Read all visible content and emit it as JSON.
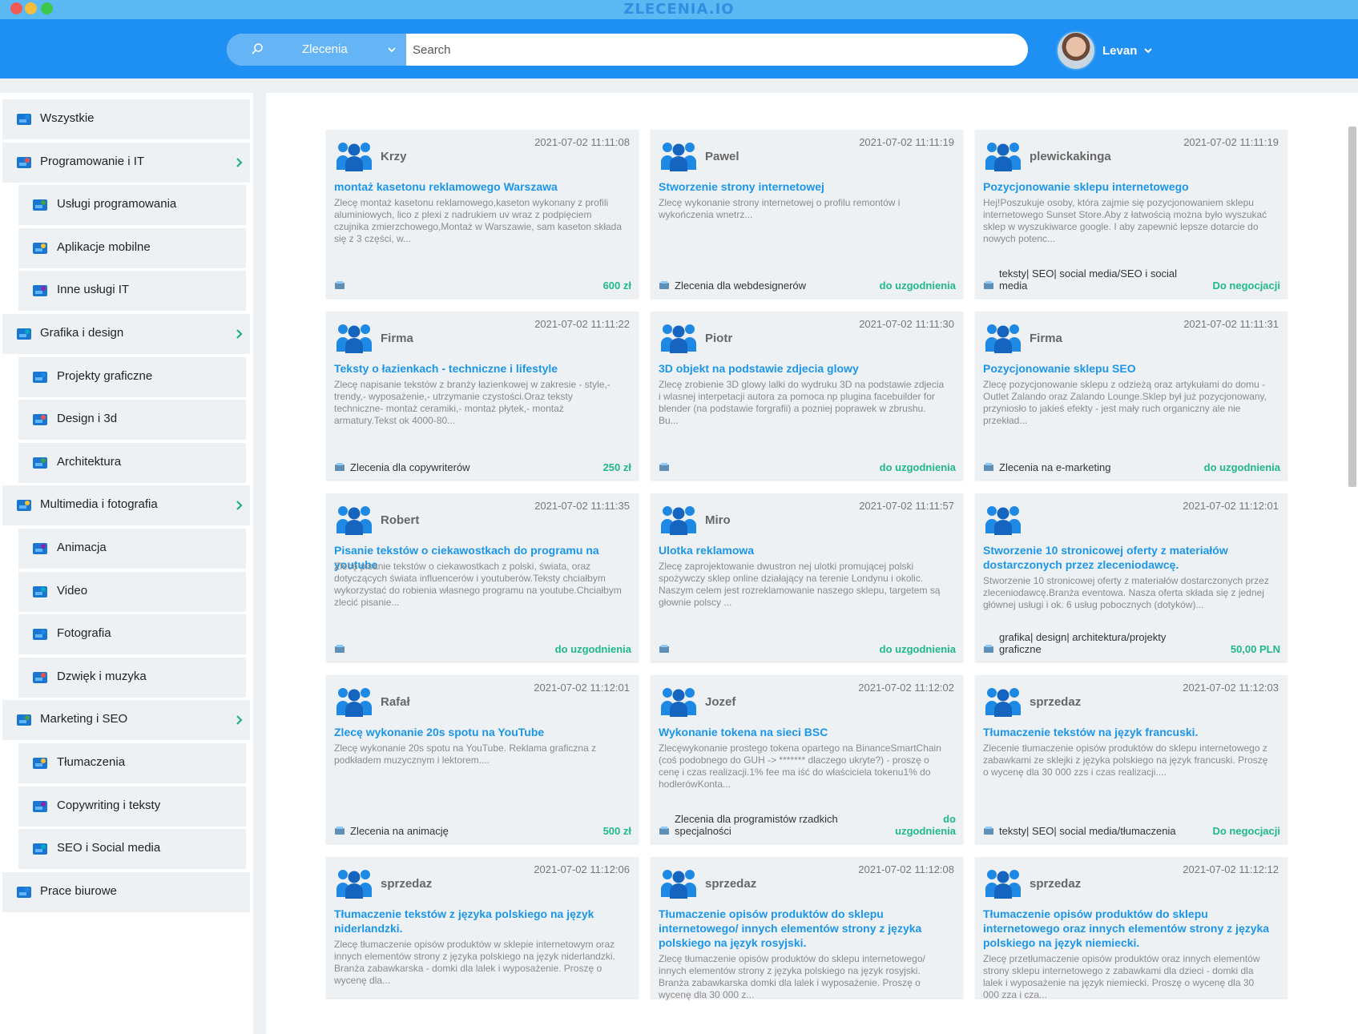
{
  "app": {
    "title": "ZLECENIA.IO"
  },
  "search": {
    "category": "Zlecenia",
    "placeholder": "Search"
  },
  "user": {
    "name": "Levan"
  },
  "sidebar": {
    "items": [
      {
        "label": "Wszystkie",
        "level": "top",
        "arrow": false,
        "icon": "network-icon"
      },
      {
        "label": "Programowanie i IT",
        "level": "top",
        "arrow": true,
        "icon": "molecule-icon"
      },
      {
        "label": "Usługi programowania",
        "level": "sub",
        "arrow": false,
        "icon": "molecule-icon"
      },
      {
        "label": "Aplikacje mobilne",
        "level": "sub",
        "arrow": false,
        "icon": "mobile-icon"
      },
      {
        "label": "Inne usługi IT",
        "level": "sub",
        "arrow": false,
        "icon": "laptop-icon"
      },
      {
        "label": "Grafika i design",
        "level": "top",
        "arrow": true,
        "icon": "pen-tool-icon"
      },
      {
        "label": "Projekty graficzne",
        "level": "sub",
        "arrow": false,
        "icon": "browser-window-icon"
      },
      {
        "label": "Design i 3d",
        "level": "sub",
        "arrow": false,
        "icon": "cube-icon"
      },
      {
        "label": "Architektura",
        "level": "sub",
        "arrow": false,
        "icon": "compass-icon"
      },
      {
        "label": "Multimedia i fotografia",
        "level": "top",
        "arrow": true,
        "icon": "camera-icon"
      },
      {
        "label": "Animacja",
        "level": "sub",
        "arrow": false,
        "icon": "lamp-icon"
      },
      {
        "label": "Video",
        "level": "sub",
        "arrow": false,
        "icon": "video-icon"
      },
      {
        "label": "Fotografia",
        "level": "sub",
        "arrow": false,
        "icon": "photo-icon"
      },
      {
        "label": "Dzwięk i muzyka",
        "level": "sub",
        "arrow": false,
        "icon": "music-icon"
      },
      {
        "label": "Marketing i SEO",
        "level": "top",
        "arrow": true,
        "icon": "chart-monitor-icon"
      },
      {
        "label": "Tłumaczenia",
        "level": "sub",
        "arrow": false,
        "icon": "translate-icon"
      },
      {
        "label": "Copywriting i teksty",
        "level": "sub",
        "arrow": false,
        "icon": "typewriter-icon"
      },
      {
        "label": "SEO i Social media",
        "level": "sub",
        "arrow": false,
        "icon": "social-icon"
      },
      {
        "label": "Prace biurowe",
        "level": "top",
        "arrow": false,
        "icon": "office-building-icon"
      }
    ]
  },
  "listings": [
    {
      "user": "Krzy",
      "date": "2021-07-02 11:11:08",
      "title": "montaż kasetonu reklamowego Warszawa",
      "desc": "Zlecę montaż kasetonu reklamowego,kaseton wykonany z profili aluminiowych, lico z plexi z nadrukiem uv wraz z podpięciem czujnika zmierzchowego,Montaż w Warszawie, sam kaseton składa się z 3 części, w...",
      "category": "",
      "price": "600 zł"
    },
    {
      "user": "Pawel",
      "date": "2021-07-02 11:11:19",
      "title": "Stworzenie strony internetowej",
      "desc": "Zlecę wykonanie strony internetowej o profilu remontów i wykończenia wnetrz...",
      "category": "Zlecenia dla webdesignerów",
      "price": "do uzgodnienia"
    },
    {
      "user": "plewickakinga",
      "date": "2021-07-02 11:11:19",
      "title": "Pozycjonowanie sklepu internetowego",
      "desc": "Hej!Poszukuje osoby, która zajmie się pozycjonowaniem sklepu internetowego Sunset Store.Aby z łatwością można było wyszukać sklep w wyszukiwarce google. I aby zapewnić lepsze dotarcie do nowych potenc...",
      "category": "teksty| SEO| social media/SEO i social media",
      "price": "Do negocjacji"
    },
    {
      "user": "Firma",
      "date": "2021-07-02 11:11:22",
      "title": "Teksty o łazienkach - techniczne i lifestyle",
      "desc": "Zlecę napisanie tekstów z branży łazienkowej w zakresie - style,- trendy,- wyposażenie,- utrzymanie czystości.Oraz teksty techniczne- montaż ceramiki,- montaż płytek,- montaż armatury.Tekst ok 4000-80...",
      "category": "Zlecenia dla copywriterów",
      "price": "250 zł"
    },
    {
      "user": "Piotr",
      "date": "2021-07-02 11:11:30",
      "title": "3D objekt na podstawie zdjecia glowy",
      "desc": "Zlecę zrobienie 3D glowy lalki do wydruku 3D na podstawie zdjecia i wlasnej interpetacji autora za pomoca np plugina facebuilder for blender (na podstawie forgrafii) a pozniej poprawek w zbrushu. Bu...",
      "category": "",
      "price": "do uzgodnienia"
    },
    {
      "user": "Firma",
      "date": "2021-07-02 11:11:31",
      "title": "Pozycjonowanie sklepu SEO",
      "desc": "Zlecę pozycjonowanie sklepu z odzieżą oraz artykułami do domu - Outlet Zalando oraz Zalando Lounge.Sklep był już pozycjonowany, przyniosło to jakieś efekty - jest mały ruch organiczny ale nie przekład...",
      "category": "Zlecenia na e-marketing",
      "price": "do uzgodnienia"
    },
    {
      "user": "Robert",
      "date": "2021-07-02 11:11:35",
      "title": "Pisanie tekstów o ciekawostkach do programu na youtube",
      "desc": "Zlecę pisanie tekstów o ciekawostkach z polski, świata, oraz dotyczących świata influencerów i youtuberów.Teksty chciałbym wykorzystać do robienia własnego programu na youtube.Chciałbym zlecić pisanie...",
      "category": "",
      "price": "do uzgodnienia"
    },
    {
      "user": "Miro",
      "date": "2021-07-02 11:11:57",
      "title": "Ulotka reklamowa",
      "desc": "Zlecę zaprojektowanie dwustron nej ulotki promującej polski spożywczy sklep online działający na terenie Londynu i okolic. Naszym celem jest rozreklamowanie naszego sklepu, targetem są głownie polscy ...",
      "category": "",
      "price": "do uzgodnienia"
    },
    {
      "user": "",
      "date": "2021-07-02 11:12:01",
      "title": "Stworzenie 10 stronicowej oferty z materiałów dostarczonych przez zleceniodawcę.",
      "desc": "Stworzenie 10 stronicowej oferty z materiałów dostarczonych przez zleceniodawcę.Branża eventowa. Nasza oferta składa się z jednej głównej usługi i ok. 6 usług pobocznych (dotyków)...",
      "category": "grafika| design| architektura/projekty graficzne",
      "price": "50,00 PLN"
    },
    {
      "user": "Rafał",
      "date": "2021-07-02 11:12:01",
      "title": "Zlecę wykonanie 20s spotu na YouTube",
      "desc": "Zlecę wykonanie 20s spotu na YouTube. Reklama graficzna z podkładem muzycznym i lektorem....",
      "category": "Zlecenia na animację",
      "price": "500 zł"
    },
    {
      "user": "Jozef",
      "date": "2021-07-02 11:12:02",
      "title": "Wykonanie tokena na sieci BSC",
      "desc": "Zlecęwykonanie prostego tokena opartego na BinanceSmartChain (coś podobnego do GUH -> ******* dlaczego ukryte?) - proszę o cenę i czas realizacji.1% fee ma iść do właściciela tokenu1% do hodlerówKonta...",
      "category": "Zlecenia dla programistów rzadkich specjalności",
      "price": "do uzgodnienia"
    },
    {
      "user": "sprzedaz",
      "date": "2021-07-02 11:12:03",
      "title": "Tłumaczenie tekstów na język francuski.",
      "desc": "Zlecenie tłumaczenie opisów produktów do sklepu internetowego z zabawkami ze sklejki z języka polskiego na język francuski. Proszę o wycenę dla 30 000 zzs i czas realizacji....",
      "category": "teksty| SEO| social media/tłumaczenia",
      "price": "Do negocjacji"
    },
    {
      "user": "sprzedaz",
      "date": "2021-07-02 11:12:06",
      "title": "Tłumaczenie tekstów z języka polskiego na język niderlandzki.",
      "desc": "Zlecę tłumaczenie opisów produktów w sklepie internetowym oraz innych elementów strony z języka polskiego na język niderlandzki. Branża zabawkarska - domki dla lalek i wyposażenie. Proszę o wycenę dla...",
      "category": "",
      "price": ""
    },
    {
      "user": "sprzedaz",
      "date": "2021-07-02 11:12:08",
      "title": "Tłumaczenie opisów produktów do sklepu internetowego/ innych elementów strony z języka polskiego na język rosyjski.",
      "desc": "Zlecę tłumaczenie opisów produktów do sklepu internetowego/ innych elementów strony z języka polskiego na język rosyjski. Branża zabawkarska domki dla lalek i wyposażenie. Proszę o wycenę dla 30 000 z...",
      "category": "",
      "price": ""
    },
    {
      "user": "sprzedaz",
      "date": "2021-07-02 11:12:12",
      "title": "Tłumaczenie opisów produktów do sklepu internetowego oraz innych elementów strony z języka polskiego na język niemiecki.",
      "desc": "Zlecę przetłumaczenie opisów produktów oraz innych elementów strony sklepu internetowego z zabawkami dla dzieci - domki dla lalek i wyposażenie na język niemiecki. Proszę o wycenę dla 30 000 zza i cza...",
      "category": "",
      "price": ""
    }
  ]
}
